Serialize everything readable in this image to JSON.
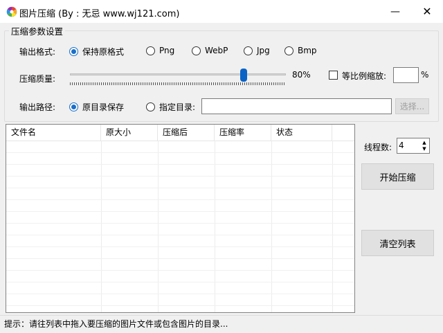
{
  "window": {
    "title": "图片压缩 (By : 无忌   www.wj121.com)",
    "minimize_glyph": "—",
    "maximize_glyph": "☐",
    "close_glyph": "✕",
    "icon": "app-color-wheel-icon"
  },
  "settings": {
    "group_title": "压缩参数设置",
    "format_label": "输出格式:",
    "formats": [
      {
        "label": "保持原格式",
        "checked": true
      },
      {
        "label": "Png",
        "checked": false
      },
      {
        "label": "WebP",
        "checked": false
      },
      {
        "label": "Jpg",
        "checked": false
      },
      {
        "label": "Bmp",
        "checked": false
      }
    ],
    "quality_label": "压缩质量:",
    "quality_value": 0.8,
    "quality_text": "80%",
    "scale_label": "等比例缩放:",
    "scale_checked": false,
    "scale_value": "",
    "scale_unit": "%",
    "path_label": "输出路径:",
    "path_options": [
      {
        "label": "原目录保存",
        "checked": true
      },
      {
        "label": "指定目录:",
        "checked": false
      }
    ],
    "path_value": "",
    "browse_button": "选择..."
  },
  "file_list": {
    "columns": [
      "文件名",
      "原大小",
      "压缩后",
      "压缩率",
      "状态"
    ],
    "rows": []
  },
  "threads": {
    "label": "线程数:",
    "value": "4"
  },
  "actions": {
    "start": "开始压缩",
    "clear": "清空列表"
  },
  "status": {
    "text": "提示：请往列表中拖入要压缩的图片文件或包含图片的目录..."
  },
  "colors": {
    "accent": "#1a6fc9",
    "slider_thumb": "#0b63c5"
  }
}
